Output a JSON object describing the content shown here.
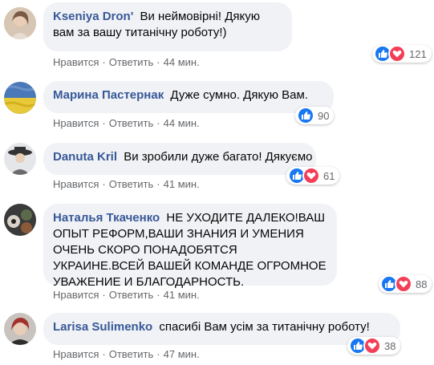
{
  "comments": [
    {
      "author": "Kseniya Dron'",
      "text": "Ви неймовірні! Дякую вам за вашу титанічну роботу!)",
      "like_label": "Нравится",
      "reply_label": "Ответить",
      "time": "44 мин.",
      "reaction_count": "121",
      "reactions": [
        "like",
        "love"
      ]
    },
    {
      "author": "Марина Пастернак",
      "text": "Дуже сумно. Дякую Вам.",
      "like_label": "Нравится",
      "reply_label": "Ответить",
      "time": "44 мин.",
      "reaction_count": "90",
      "reactions": [
        "like"
      ]
    },
    {
      "author": "Danuta Kril",
      "text": "Ви зробили дуже багато! Дякуємо",
      "like_label": "Нравится",
      "reply_label": "Ответить",
      "time": "41 мин.",
      "reaction_count": "61",
      "reactions": [
        "like",
        "love"
      ]
    },
    {
      "author": "Наталья Ткаченко",
      "text": "НЕ УХОДИТЕ ДАЛЕКО!ВАШ ОПЫТ РЕФОРМ,ВАШИ ЗНАНИЯ И УМЕНИЯ ОЧЕНЬ СКОРО ПОНАДОБЯТСЯ УКРАИНЕ.ВСЕЙ ВАШЕЙ КОМАНДЕ ОГРОМНОЕ УВАЖЕНИЕ И БЛАГОДАРНОСТЬ.",
      "like_label": "Нравится",
      "reply_label": "Ответить",
      "time": "41 мин.",
      "reaction_count": "88",
      "reactions": [
        "like",
        "love"
      ]
    },
    {
      "author": "Larisa Sulimenko",
      "text": "спасибі Вам усім за титанічну роботу!",
      "like_label": "Нравится",
      "reply_label": "Ответить",
      "time": "47 мин.",
      "reaction_count": "38",
      "reactions": [
        "like",
        "love"
      ]
    }
  ],
  "colors": {
    "author": "#385898",
    "bubble": "#f0f2f5",
    "meta": "#65676b",
    "like": "#1877f2",
    "love": "#f33e58"
  }
}
